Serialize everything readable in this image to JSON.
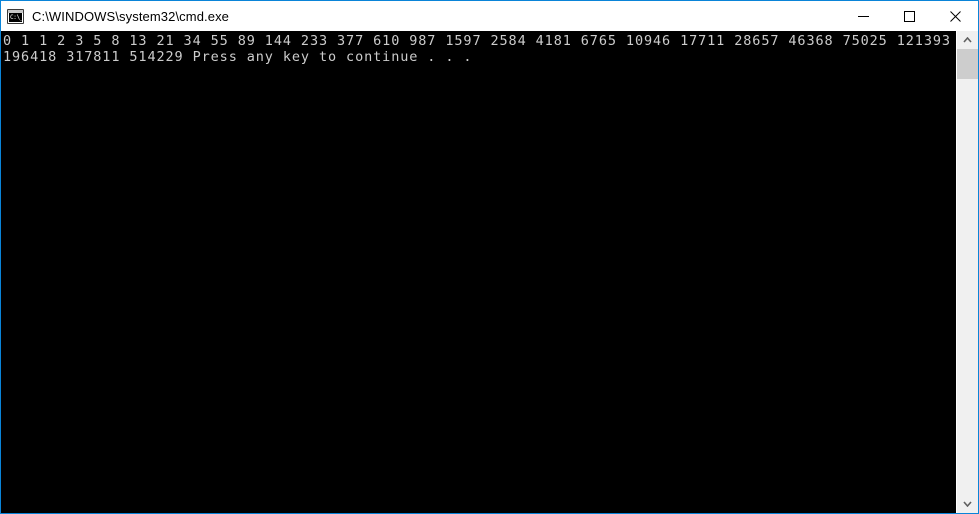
{
  "window": {
    "title": "C:\\WINDOWS\\system32\\cmd.exe",
    "icon": "cmd-console-icon",
    "icon_prompt": "C:\\_",
    "border_color": "#0a84d8",
    "titlebar_background": "#ffffff",
    "console_background": "#000000",
    "console_foreground": "#cccccc"
  },
  "controls": {
    "minimize_label": "Minimize",
    "maximize_label": "Maximize",
    "close_label": "Close"
  },
  "console": {
    "output": "0 1 1 2 3 5 8 13 21 34 55 89 144 233 377 610 987 1597 2584 4181 6765 10946 17711 28657 46368 75025 121393 196418 317811 514229 Press any key to continue . . ."
  },
  "scrollbar": {
    "up_arrow": "chevron-up-icon",
    "down_arrow": "chevron-down-icon",
    "thumb_position_percent": 0,
    "thumb_size_percent": 7
  },
  "sequence_data": {
    "type": "fibonacci-sequence",
    "values": [
      0,
      1,
      1,
      2,
      3,
      5,
      8,
      13,
      21,
      34,
      55,
      89,
      144,
      233,
      377,
      610,
      987,
      1597,
      2584,
      4181,
      6765,
      10946,
      17711,
      28657,
      46368,
      75025,
      121393,
      196418,
      317811,
      514229
    ],
    "count": 30,
    "prompt": "Press any key to continue . . ."
  }
}
